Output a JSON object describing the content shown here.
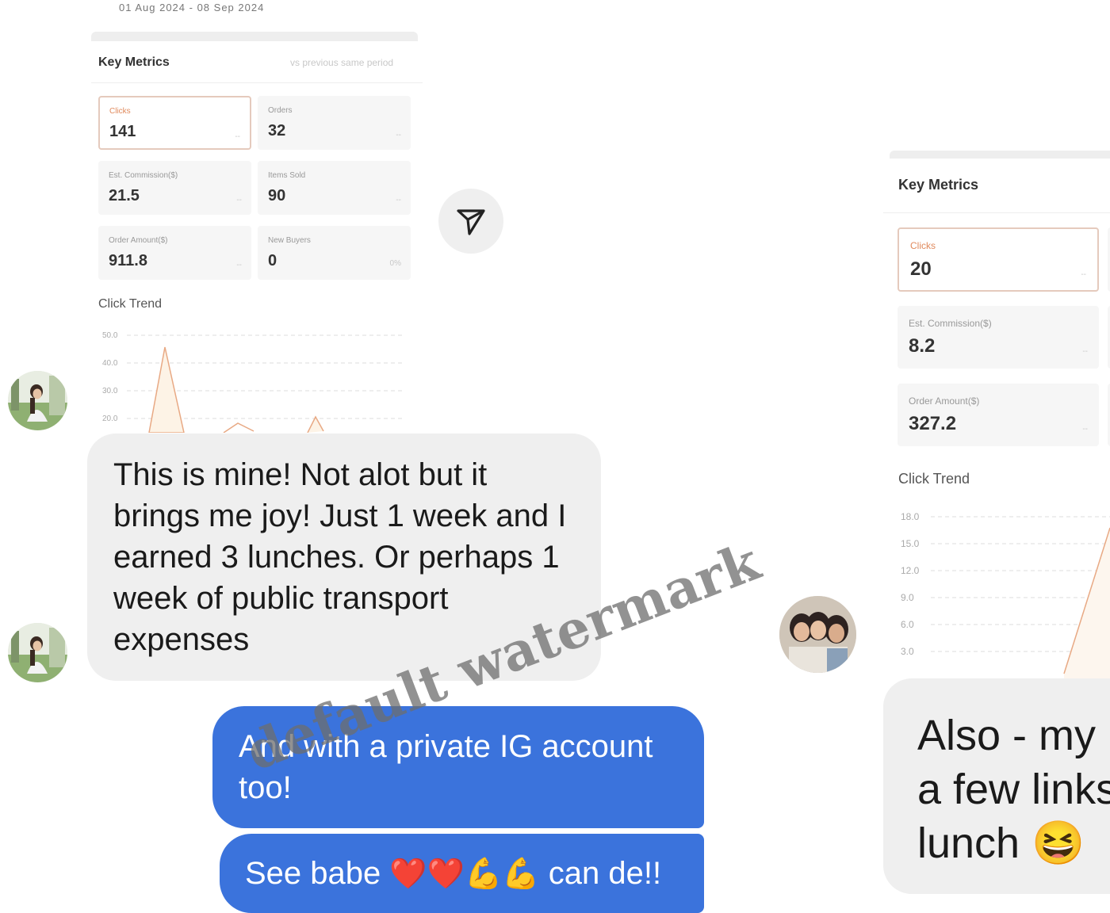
{
  "left_screenshot": {
    "date_range": "01 Aug 2024 - 08 Sep 2024",
    "key_metrics_title": "Key Metrics",
    "comparison_label": "vs previous same period",
    "metrics": [
      {
        "label": "Clicks",
        "value": "141",
        "trail": "--"
      },
      {
        "label": "Orders",
        "value": "32",
        "trail": "--"
      },
      {
        "label": "Est. Commission($)",
        "value": "21.5",
        "trail": "--"
      },
      {
        "label": "Items Sold",
        "value": "90",
        "trail": "--"
      },
      {
        "label": "Order Amount($)",
        "value": "911.8",
        "trail": "--"
      },
      {
        "label": "New Buyers",
        "value": "0",
        "trail": "0%"
      }
    ],
    "click_trend_title": "Click Trend",
    "y_ticks": [
      "50.0",
      "40.0",
      "30.0",
      "20.0"
    ]
  },
  "right_screenshot": {
    "key_metrics_title": "Key Metrics",
    "metrics": [
      {
        "label": "Clicks",
        "value": "20",
        "trail": "--"
      },
      {
        "label": "Est. Commission($)",
        "value": "8.2",
        "trail": "--"
      },
      {
        "label": "Order Amount($)",
        "value": "327.2",
        "trail": "--"
      }
    ],
    "click_trend_title": "Click Trend",
    "y_ticks": [
      "18.0",
      "15.0",
      "12.0",
      "9.0",
      "6.0",
      "3.0"
    ]
  },
  "messages": {
    "incoming_1": "This is mine! Not alot but it brings me joy! Just 1 week and I earned 3 lunches. Or perhaps 1 week of public transport expenses",
    "outgoing_1": "And with a private IG account too!",
    "outgoing_2_text_a": "See babe ",
    "outgoing_2_emojis": "❤️❤️💪💪",
    "outgoing_2_text_b": " can de!!",
    "incoming_right_line1": "Also - my",
    "incoming_right_line2": "a few links",
    "incoming_right_line3": "lunch",
    "incoming_right_emoji": "😆"
  },
  "watermark": "default watermark",
  "icons": {
    "send": "send-icon",
    "avatar1": "avatar-woman-outdoors",
    "avatar2": "avatar-group-photo"
  },
  "colors": {
    "outgoing_bubble": "#3b73dc",
    "incoming_bubble": "#efefef",
    "active_metric_border": "#e5cabd",
    "trend_line": "#e8a984"
  }
}
